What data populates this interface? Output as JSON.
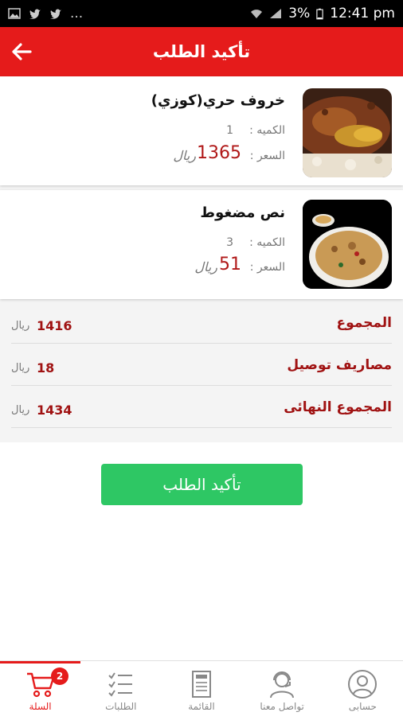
{
  "status_bar": {
    "battery": "3%",
    "time": "12:41 pm",
    "extra": "..."
  },
  "header": {
    "title": "تأكيد الطلب"
  },
  "items": [
    {
      "name": "خروف حري(كوزي)",
      "qty_label": "الكميه :",
      "qty": "1",
      "price_label": "السعر :",
      "price": "1365",
      "currency": "ريال"
    },
    {
      "name": "نص مضغوط",
      "qty_label": "الكميه :",
      "qty": "3",
      "price_label": "السعر :",
      "price": "51",
      "currency": "ريال"
    }
  ],
  "totals": {
    "subtotal": {
      "label": "المجموع",
      "value": "1416",
      "currency": "ريال"
    },
    "delivery": {
      "label": "مصاريف توصيل",
      "value": "18",
      "currency": "ريال"
    },
    "final": {
      "label": "المجموع النهائى",
      "value": "1434",
      "currency": "ريال"
    }
  },
  "confirm_label": "تأكيد الطلب",
  "bottom_nav": [
    {
      "label": "السلة",
      "badge": "2",
      "icon": "cart-icon",
      "active": true
    },
    {
      "label": "الطلبات",
      "icon": "orders-list-icon"
    },
    {
      "label": "القائمة",
      "icon": "menu-icon"
    },
    {
      "label": "تواصل معنا",
      "icon": "support-agent-icon"
    },
    {
      "label": "حسابى",
      "icon": "account-icon"
    }
  ],
  "colors": {
    "brand_red": "#e51b1b",
    "price_red": "#b01818",
    "confirm_green": "#2ec764"
  }
}
